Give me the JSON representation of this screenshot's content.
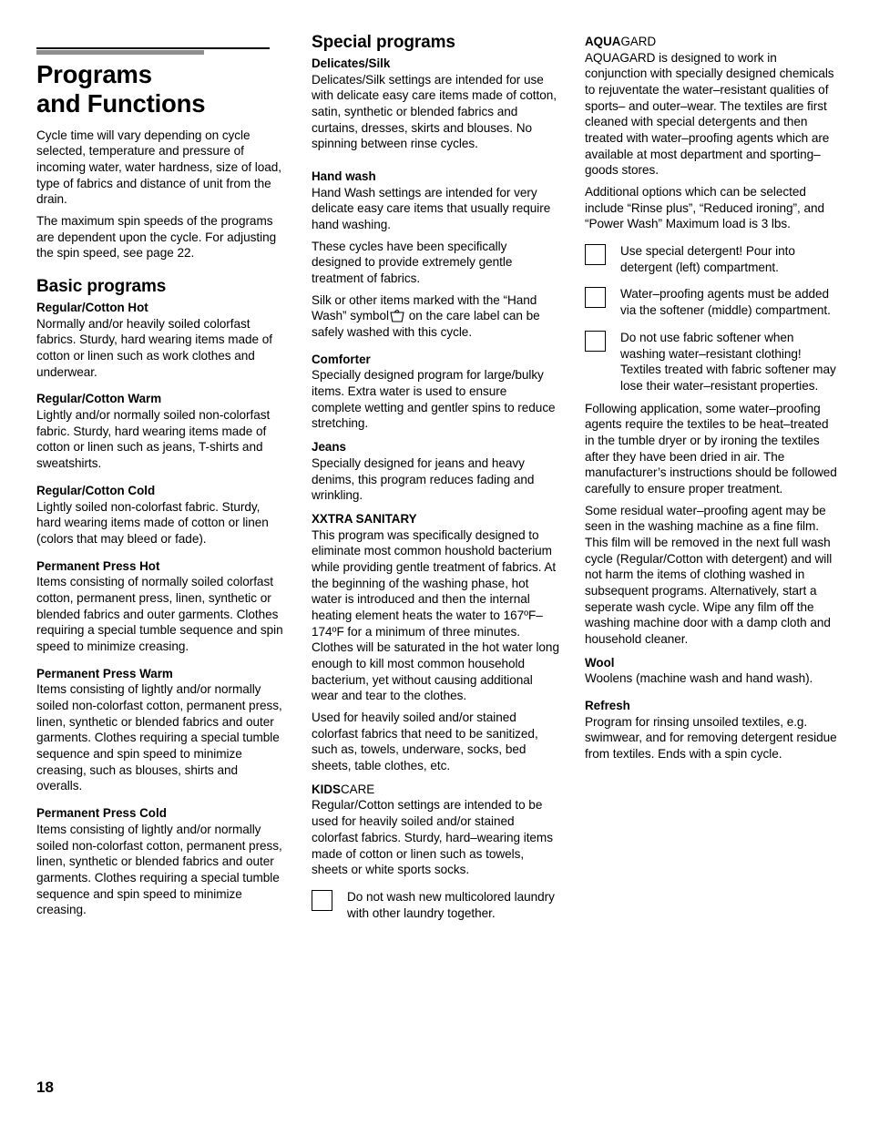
{
  "page": {
    "folio": "18"
  },
  "col1": {
    "title_line1": "Programs",
    "title_line2": "and Functions",
    "intro_p1": "Cycle time will vary depending on cycle selected, temperature and pressure of incoming water, water hardness, size of load, type of fabrics and distance of unit from the drain.",
    "intro_p2": "The maximum spin speeds of the programs are dependent upon the cycle. For adjusting the spin speed, see page 22.",
    "section_heading": "Basic programs",
    "programs": [
      {
        "name": "Regular/Cotton Hot",
        "body": "Normally and/or heavily soiled colorfast fabrics. Sturdy, hard wearing items made of cotton or linen such as work clothes and underwear."
      },
      {
        "name": "Regular/Cotton Warm",
        "body": "Lightly and/or normally soiled non-colorfast fabric. Sturdy, hard wearing items made of cotton or linen such as jeans, T-shirts and sweatshirts."
      },
      {
        "name": "Regular/Cotton Cold",
        "body": "Lightly soiled non-colorfast fabric. Sturdy, hard wearing items made of cotton or linen (colors that may bleed or fade)."
      },
      {
        "name": "Permanent Press Hot",
        "body": "Items consisting of normally soiled colorfast cotton, permanent press, linen, synthetic or blended fabrics and outer garments. Clothes requiring a special tumble sequence and spin speed to minimize creasing."
      },
      {
        "name": "Permanent Press Warm",
        "body": "Items consisting of lightly and/or normally soiled non-colorfast cotton, permanent press, linen, synthetic or blended fabrics and outer garments. Clothes requiring a special tumble sequence and spin speed to minimize creasing, such as blouses, shirts and overalls."
      },
      {
        "name": "Permanent Press Cold",
        "body": "Items consisting of lightly and/or normally soiled non-colorfast cotton, permanent press, linen, synthetic or blended fabrics and outer garments. Clothes requiring a special tumble sequence and spin speed to minimize creasing."
      }
    ]
  },
  "col2": {
    "section_heading": "Special programs",
    "delicates_heading": "Delicates/Silk",
    "delicates_body": "Delicates/Silk settings are intended for use with delicate easy care items made of cotton, satin, synthetic or blended fabrics and curtains, dresses, skirts and blouses.  No spinning between rinse cycles.",
    "handwash_heading": "Hand wash",
    "handwash_p1": "Hand Wash settings are intended for very delicate easy care items that usually require hand washing.",
    "handwash_p2": "These cycles have been specifically designed to provide extremely gentle treatment of fabrics.",
    "handwash_p3_before": "Silk or other items marked with the “Hand Wash” symbol",
    "handwash_symbol_name": "hand-wash-care-symbol",
    "handwash_p3_after": "on the care label can be safely washed with this cycle.",
    "comforter_heading": "Comforter",
    "comforter_body": "Specially designed program for large/bulky items.  Extra water is used to ensure complete wetting and gentler spins to reduce stretching.",
    "jeans_heading": "Jeans",
    "jeans_body": "Specially designed for jeans and heavy denims, this program reduces fading and wrinkling.",
    "xxtra_heading": "XXTRA SANITARY",
    "xxtra_p1": "This program was specifically designed to eliminate most common houshold bacterium while providing gentle treatment of fabrics.  At the beginning of the washing phase, hot water is introduced and then the internal heating element heats the water to 167ºF–174ºF for a minimum of three minutes.  Clothes will be saturated in the hot water long enough to kill most common household bacterium, yet without causing additional wear and tear to the clothes.",
    "xxtra_p2": "Used for heavily soiled and/or stained colorfast fabrics that need to be sanitized, such as, towels, underware, socks, bed sheets, table clothes, etc.",
    "kidscare_heading_strong": "KIDS",
    "kidscare_heading_light": "CARE",
    "kidscare_body": "Regular/Cotton settings are intended to be used for heavily soiled and/or stained colorfast fabrics. Sturdy, hard–wearing items made of cotton or linen such as towels, sheets or white sports socks.",
    "note": "Do not wash new multicolored laundry with other laundry together."
  },
  "col3": {
    "aquagard_heading_strong": "AQUA",
    "aquagard_heading_light": "GARD",
    "aquagard_p1": "AQUAGARD is designed to work in conjunction with specially designed chemicals to rejuventate the water–resistant qualities of sports– and outer–wear.  The textiles are first cleaned with special detergents and then treated with water–proofing agents which are available at most department and sporting–goods stores.",
    "aquagard_p2": "Additional options which can be selected include “Rinse plus”, “Reduced ironing”, and “Power Wash” Maximum load is 3 lbs.",
    "notes": [
      "Use special detergent!  Pour into detergent (left) compartment.",
      "Water–proofing agents must be added via the softener (middle) compartment.",
      "Do not use fabric softener when washing water–resistant clothing! Textiles treated with fabric softener may lose their water–resistant properties."
    ],
    "after_notes_p1": "Following application, some water–proofing agents require the textiles to be heat–treated  in the tumble dryer or by ironing the textiles after they have been dried in air.  The manufacturer’s instructions should be followed carefully to ensure proper treatment.",
    "after_notes_p2": "Some residual water–proofing agent may be seen in the washing machine as a fine film.  This film will be removed in the next full wash cycle (Regular/Cotton with detergent) and will not harm the items of clothing washed in subsequent programs.  Alternatively, start a seperate wash cycle.  Wipe any film off the washing machine door with a damp cloth and household cleaner.",
    "wool_heading": "Wool",
    "wool_body": "Woolens (machine wash and hand wash).",
    "refresh_heading": "Refresh",
    "refresh_body": "Program for rinsing unsoiled textiles, e.g. swimwear, and for removing detergent residue from textiles. Ends with a spin cycle."
  },
  "colors": {
    "rule_black": "#000000",
    "rule_gray": "#8e8e8e",
    "text": "#000000",
    "page_background": "#ffffff"
  }
}
